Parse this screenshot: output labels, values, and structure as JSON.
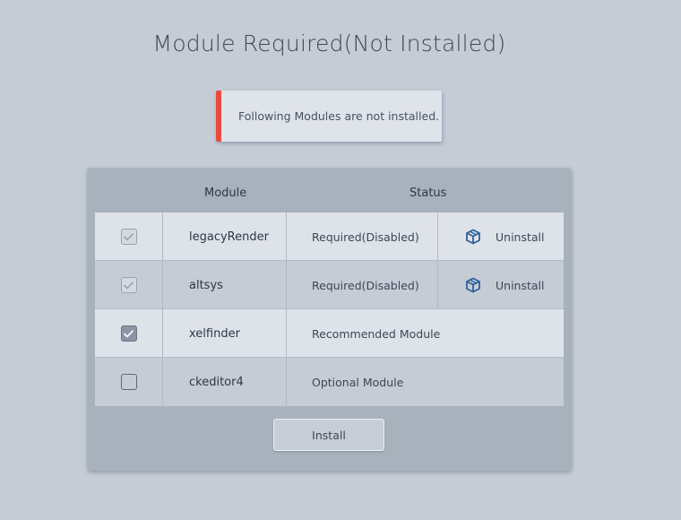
{
  "page": {
    "title": "Module Required(Not Installed)"
  },
  "alert": {
    "message": "Following Modules are not installed.",
    "accent_color": "#e84a3c"
  },
  "table": {
    "headers": {
      "module": "Module",
      "status": "Status"
    },
    "rows": [
      {
        "name": "legacyRender",
        "status": "Required(Disabled)",
        "checkbox": "checked-disabled",
        "action": "Uninstall",
        "action_icon": "package-icon"
      },
      {
        "name": "altsys",
        "status": "Required(Disabled)",
        "checkbox": "checked-disabled",
        "action": "Uninstall",
        "action_icon": "package-icon"
      },
      {
        "name": "xelfinder",
        "status": "Recommended Module",
        "checkbox": "checked"
      },
      {
        "name": "ckeditor4",
        "status": "Optional Module",
        "checkbox": "unchecked"
      }
    ]
  },
  "install_button": {
    "label": "Install"
  },
  "colors": {
    "background": "#c5ccd6",
    "panel": "#a8b2bd",
    "row_light": "#dee2e9",
    "row_dark": "#c5ccd6",
    "icon_blue": "#2f5f9a"
  }
}
